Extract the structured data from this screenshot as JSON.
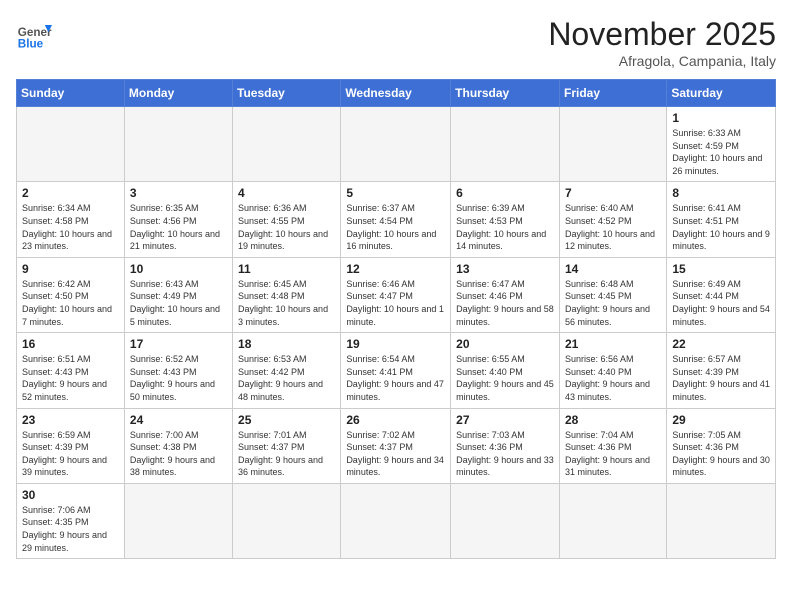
{
  "logo": {
    "text_general": "General",
    "text_blue": "Blue"
  },
  "header": {
    "month": "November 2025",
    "location": "Afragola, Campania, Italy"
  },
  "days_of_week": [
    "Sunday",
    "Monday",
    "Tuesday",
    "Wednesday",
    "Thursday",
    "Friday",
    "Saturday"
  ],
  "weeks": [
    [
      {
        "day": "",
        "info": ""
      },
      {
        "day": "",
        "info": ""
      },
      {
        "day": "",
        "info": ""
      },
      {
        "day": "",
        "info": ""
      },
      {
        "day": "",
        "info": ""
      },
      {
        "day": "",
        "info": ""
      },
      {
        "day": "1",
        "info": "Sunrise: 6:33 AM\nSunset: 4:59 PM\nDaylight: 10 hours and 26 minutes."
      }
    ],
    [
      {
        "day": "2",
        "info": "Sunrise: 6:34 AM\nSunset: 4:58 PM\nDaylight: 10 hours and 23 minutes."
      },
      {
        "day": "3",
        "info": "Sunrise: 6:35 AM\nSunset: 4:56 PM\nDaylight: 10 hours and 21 minutes."
      },
      {
        "day": "4",
        "info": "Sunrise: 6:36 AM\nSunset: 4:55 PM\nDaylight: 10 hours and 19 minutes."
      },
      {
        "day": "5",
        "info": "Sunrise: 6:37 AM\nSunset: 4:54 PM\nDaylight: 10 hours and 16 minutes."
      },
      {
        "day": "6",
        "info": "Sunrise: 6:39 AM\nSunset: 4:53 PM\nDaylight: 10 hours and 14 minutes."
      },
      {
        "day": "7",
        "info": "Sunrise: 6:40 AM\nSunset: 4:52 PM\nDaylight: 10 hours and 12 minutes."
      },
      {
        "day": "8",
        "info": "Sunrise: 6:41 AM\nSunset: 4:51 PM\nDaylight: 10 hours and 9 minutes."
      }
    ],
    [
      {
        "day": "9",
        "info": "Sunrise: 6:42 AM\nSunset: 4:50 PM\nDaylight: 10 hours and 7 minutes."
      },
      {
        "day": "10",
        "info": "Sunrise: 6:43 AM\nSunset: 4:49 PM\nDaylight: 10 hours and 5 minutes."
      },
      {
        "day": "11",
        "info": "Sunrise: 6:45 AM\nSunset: 4:48 PM\nDaylight: 10 hours and 3 minutes."
      },
      {
        "day": "12",
        "info": "Sunrise: 6:46 AM\nSunset: 4:47 PM\nDaylight: 10 hours and 1 minute."
      },
      {
        "day": "13",
        "info": "Sunrise: 6:47 AM\nSunset: 4:46 PM\nDaylight: 9 hours and 58 minutes."
      },
      {
        "day": "14",
        "info": "Sunrise: 6:48 AM\nSunset: 4:45 PM\nDaylight: 9 hours and 56 minutes."
      },
      {
        "day": "15",
        "info": "Sunrise: 6:49 AM\nSunset: 4:44 PM\nDaylight: 9 hours and 54 minutes."
      }
    ],
    [
      {
        "day": "16",
        "info": "Sunrise: 6:51 AM\nSunset: 4:43 PM\nDaylight: 9 hours and 52 minutes."
      },
      {
        "day": "17",
        "info": "Sunrise: 6:52 AM\nSunset: 4:43 PM\nDaylight: 9 hours and 50 minutes."
      },
      {
        "day": "18",
        "info": "Sunrise: 6:53 AM\nSunset: 4:42 PM\nDaylight: 9 hours and 48 minutes."
      },
      {
        "day": "19",
        "info": "Sunrise: 6:54 AM\nSunset: 4:41 PM\nDaylight: 9 hours and 47 minutes."
      },
      {
        "day": "20",
        "info": "Sunrise: 6:55 AM\nSunset: 4:40 PM\nDaylight: 9 hours and 45 minutes."
      },
      {
        "day": "21",
        "info": "Sunrise: 6:56 AM\nSunset: 4:40 PM\nDaylight: 9 hours and 43 minutes."
      },
      {
        "day": "22",
        "info": "Sunrise: 6:57 AM\nSunset: 4:39 PM\nDaylight: 9 hours and 41 minutes."
      }
    ],
    [
      {
        "day": "23",
        "info": "Sunrise: 6:59 AM\nSunset: 4:39 PM\nDaylight: 9 hours and 39 minutes."
      },
      {
        "day": "24",
        "info": "Sunrise: 7:00 AM\nSunset: 4:38 PM\nDaylight: 9 hours and 38 minutes."
      },
      {
        "day": "25",
        "info": "Sunrise: 7:01 AM\nSunset: 4:37 PM\nDaylight: 9 hours and 36 minutes."
      },
      {
        "day": "26",
        "info": "Sunrise: 7:02 AM\nSunset: 4:37 PM\nDaylight: 9 hours and 34 minutes."
      },
      {
        "day": "27",
        "info": "Sunrise: 7:03 AM\nSunset: 4:36 PM\nDaylight: 9 hours and 33 minutes."
      },
      {
        "day": "28",
        "info": "Sunrise: 7:04 AM\nSunset: 4:36 PM\nDaylight: 9 hours and 31 minutes."
      },
      {
        "day": "29",
        "info": "Sunrise: 7:05 AM\nSunset: 4:36 PM\nDaylight: 9 hours and 30 minutes."
      }
    ],
    [
      {
        "day": "30",
        "info": "Sunrise: 7:06 AM\nSunset: 4:35 PM\nDaylight: 9 hours and 29 minutes."
      },
      {
        "day": "",
        "info": ""
      },
      {
        "day": "",
        "info": ""
      },
      {
        "day": "",
        "info": ""
      },
      {
        "day": "",
        "info": ""
      },
      {
        "day": "",
        "info": ""
      },
      {
        "day": "",
        "info": ""
      }
    ]
  ]
}
